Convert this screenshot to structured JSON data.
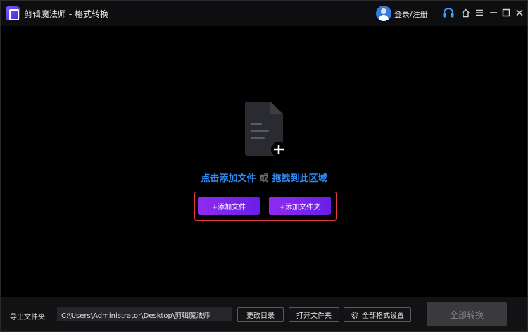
{
  "titlebar": {
    "app_title": "剪辑魔法师 - 格式转换",
    "login_label": "登录/注册",
    "icons": [
      "app-logo-icon",
      "avatar-icon",
      "headset-icon",
      "home-icon",
      "menu-icon",
      "minimize-icon",
      "maximize-icon",
      "close-icon"
    ]
  },
  "dropzone": {
    "click_add_label": "点击添加文件",
    "or_label": "或",
    "drag_label": "拖拽到此区域",
    "add_file_button": "+添加文件",
    "add_folder_button": "+添加文件夹"
  },
  "bottombar": {
    "output_folder_label": "导出文件夹:",
    "output_path": "C:\\Users\\Administrator\\Desktop\\剪辑魔法师",
    "change_dir_button": "更改目录",
    "open_folder_button": "打开文件夹",
    "all_format_settings_button": "全部格式设置",
    "convert_all_button": "全部转换"
  },
  "colors": {
    "accent_blue": "#2f8ef5",
    "accent_purple": "#8f2bf0",
    "highlight_red": "#e23b3b",
    "background": "#000000"
  }
}
